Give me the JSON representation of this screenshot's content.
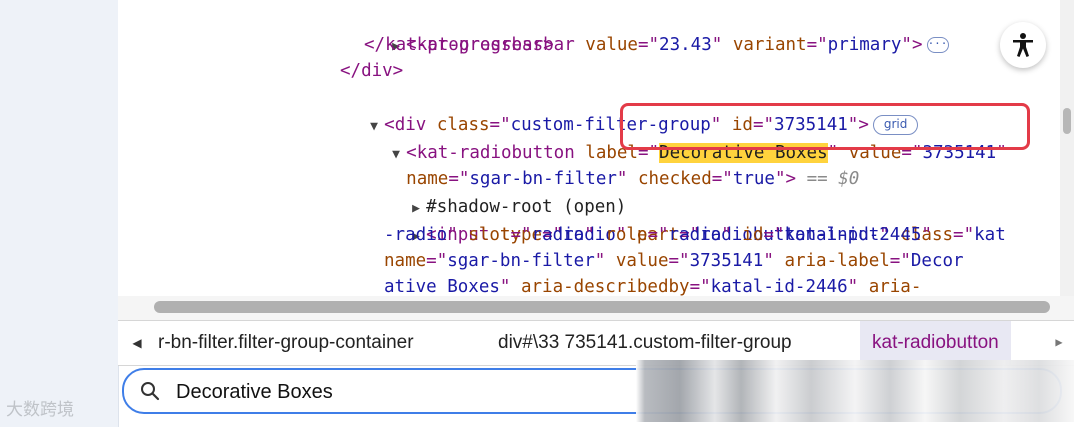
{
  "elements_panel": {
    "lines": [
      {
        "parts": [
          [
            "tag",
            "<kat-progressbar "
          ],
          [
            "attr",
            "value"
          ],
          [
            "tag",
            "=\""
          ],
          [
            "val",
            "23.43"
          ],
          [
            "tag",
            "\" "
          ],
          [
            "attr",
            "variant"
          ],
          [
            "tag",
            "=\""
          ],
          [
            "val",
            "primary"
          ],
          [
            "tag",
            "\">"
          ]
        ],
        "ellipsis": "···"
      },
      {
        "parts": [
          [
            "tag",
            "</kat-progressbar>"
          ]
        ]
      },
      {
        "parts": [
          [
            "tag",
            "</div>"
          ]
        ]
      },
      {
        "parts": [
          [
            "tag",
            "<div "
          ],
          [
            "attr",
            "class"
          ],
          [
            "tag",
            "=\""
          ],
          [
            "val",
            "custom-filter-group"
          ],
          [
            "tag",
            "\" "
          ],
          [
            "attr",
            "id"
          ],
          [
            "tag",
            "=\""
          ],
          [
            "val",
            "3735141"
          ],
          [
            "tag",
            "\">"
          ]
        ],
        "badge": "grid"
      },
      {
        "parts_a": [
          [
            "tag",
            "<kat-radiobutton "
          ],
          [
            "attr",
            "label"
          ],
          [
            "tag",
            "=\""
          ]
        ],
        "highlight": "Decorative Boxes",
        "parts_b": [
          [
            "tag",
            "\" "
          ],
          [
            "attr",
            "value"
          ],
          [
            "tag",
            "=\""
          ],
          [
            "val",
            "3735141"
          ],
          [
            "tag",
            "\""
          ]
        ]
      },
      {
        "parts": [
          [
            "attr",
            "name"
          ],
          [
            "tag",
            "=\""
          ],
          [
            "val",
            "sgar-bn-filter"
          ],
          [
            "tag",
            "\" "
          ],
          [
            "attr",
            "checked"
          ],
          [
            "tag",
            "=\""
          ],
          [
            "val",
            "true"
          ],
          [
            "tag",
            "\">"
          ]
        ],
        "equals": " == $0"
      },
      {
        "parts": [
          [
            "txt",
            "#shadow-root (open)"
          ]
        ]
      },
      {
        "parts": [
          [
            "tag",
            "<input "
          ],
          [
            "attr",
            "type"
          ],
          [
            "tag",
            "=\""
          ],
          [
            "val",
            "radio"
          ],
          [
            "tag",
            "\" "
          ],
          [
            "attr",
            "part"
          ],
          [
            "tag",
            "=\""
          ],
          [
            "val",
            "radiobutton-input"
          ],
          [
            "tag",
            "\" "
          ],
          [
            "attr",
            "class"
          ],
          [
            "tag",
            "=\""
          ],
          [
            "val",
            "kat"
          ]
        ]
      },
      {
        "parts": [
          [
            "val",
            "-radio"
          ],
          [
            "tag",
            "\" "
          ],
          [
            "attr",
            "slot"
          ],
          [
            "tag",
            "=\""
          ],
          [
            "val",
            "radio"
          ],
          [
            "tag",
            "\" "
          ],
          [
            "attr",
            "role"
          ],
          [
            "tag",
            "=\""
          ],
          [
            "val",
            "radio"
          ],
          [
            "tag",
            "\" "
          ],
          [
            "attr",
            "id"
          ],
          [
            "tag",
            "=\""
          ],
          [
            "val",
            "katal-id-2445"
          ],
          [
            "tag",
            "\""
          ]
        ]
      },
      {
        "parts": [
          [
            "attr",
            "name"
          ],
          [
            "tag",
            "=\""
          ],
          [
            "val",
            "sgar-bn-filter"
          ],
          [
            "tag",
            "\" "
          ],
          [
            "attr",
            "value"
          ],
          [
            "tag",
            "=\""
          ],
          [
            "val",
            "3735141"
          ],
          [
            "tag",
            "\" "
          ],
          [
            "attr",
            "aria-label"
          ],
          [
            "tag",
            "=\""
          ],
          [
            "val",
            "Decor"
          ]
        ]
      },
      {
        "parts": [
          [
            "val",
            "ative Boxes"
          ],
          [
            "tag",
            "\" "
          ],
          [
            "attr",
            "aria-describedby"
          ],
          [
            "tag",
            "=\""
          ],
          [
            "val",
            "katal-id-2446"
          ],
          [
            "tag",
            "\" "
          ],
          [
            "attr",
            "aria-"
          ]
        ]
      }
    ]
  },
  "breadcrumbs": [
    {
      "label": "r-bn-filter.filter-group-container"
    },
    {
      "label": "div#\\33 735141.custom-filter-group"
    },
    {
      "label": "kat-radiobutton"
    }
  ],
  "search": {
    "value": "Decorative Boxes"
  },
  "watermark": "大数跨境",
  "colors": {
    "tag": "#881280",
    "attr": "#994500",
    "value": "#1a1aa6",
    "highlight": "#ffd33d",
    "focus_border": "#3f7ee8",
    "callout": "#e33b48"
  },
  "icons": {
    "accessibility": "accessibility-icon",
    "search": "search-icon",
    "expand": "triangle-right-icon",
    "collapse": "triangle-down-icon"
  }
}
